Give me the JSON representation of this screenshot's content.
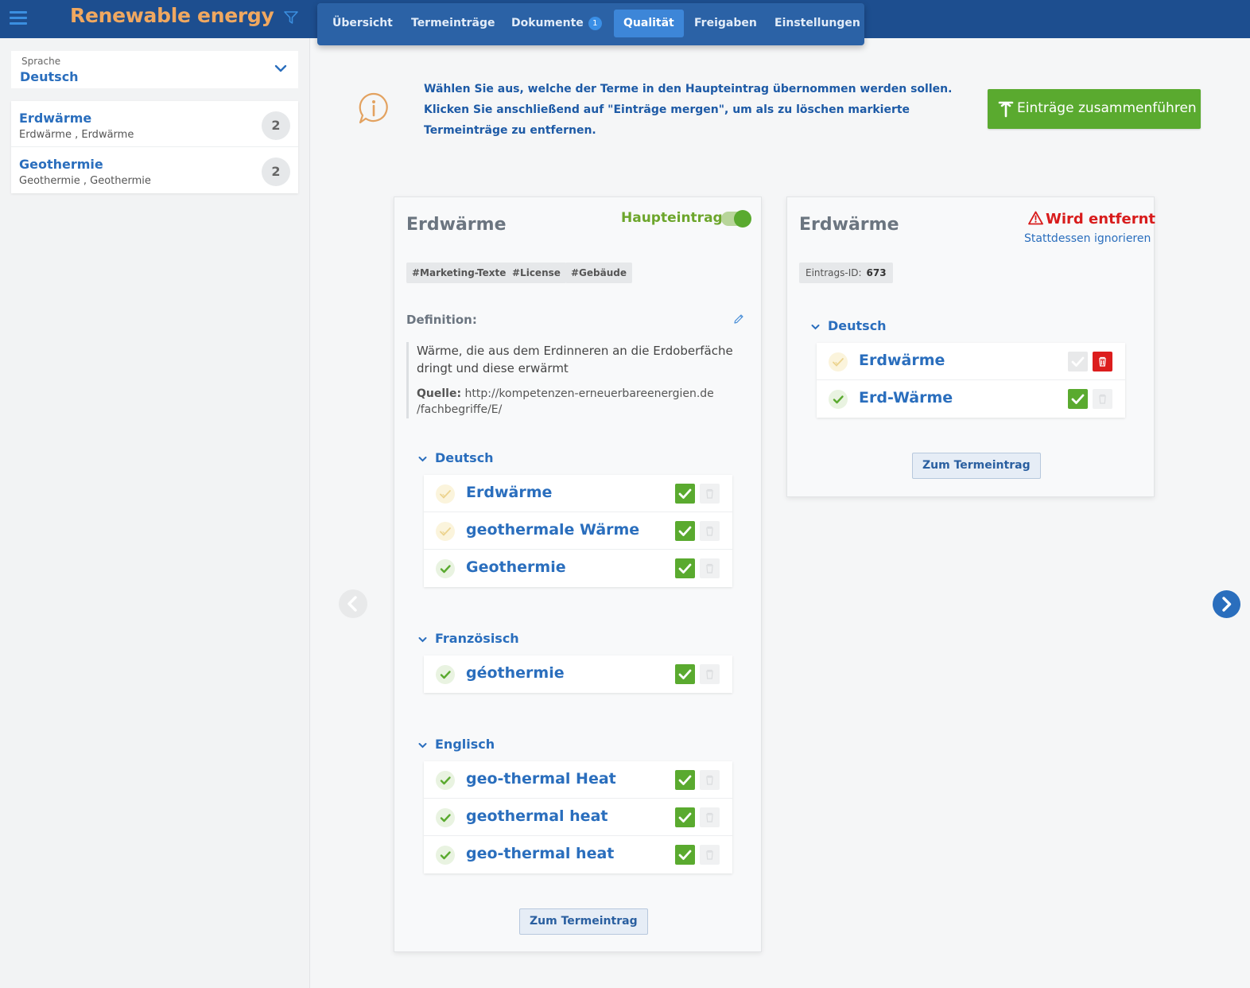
{
  "app": {
    "title": "Renewable energy"
  },
  "tabs": [
    {
      "label": "Übersicht"
    },
    {
      "label": "Termeinträge"
    },
    {
      "label": "Dokumente",
      "badge": "1"
    },
    {
      "label": "Qualität",
      "active": true
    },
    {
      "label": "Freigaben"
    },
    {
      "label": "Einstellungen"
    }
  ],
  "sidebar": {
    "language": {
      "label": "Sprache",
      "value": "Deutsch"
    },
    "entries": [
      {
        "title": "Erdwärme",
        "subtitle": "Erdwärme , Erdwärme",
        "count": "2"
      },
      {
        "title": "Geothermie",
        "subtitle": "Geothermie , Geothermie",
        "count": "2"
      }
    ]
  },
  "info": {
    "text": "Wählen Sie aus, welche der Terme in den Haupteintrag übernommen werden sollen. Klicken Sie anschließend auf \"Einträge mergen\", um als zu löschen markierte Termeinträge zu entfernen."
  },
  "merge_button": {
    "label": "Einträge zusammenführen"
  },
  "main_card": {
    "title": "Erdwärme",
    "main_entry_label": "Haupteintrag",
    "main_entry_on": true,
    "tags": [
      "#Marketing-Texte",
      "#License",
      "#Gebäude"
    ],
    "definition_label": "Definition:",
    "definition_text": "Wärme, die aus dem Erdinneren an die Erdoberfäche dringt und diese erwärmt",
    "source_label": "Quelle:",
    "source_value": "http://kompetenzen-erneuerbareenergien.de /fachbegriffe/E/",
    "languages": [
      {
        "name": "Deutsch",
        "terms": [
          {
            "text": "Erdwärme",
            "status": "pending",
            "checked": true
          },
          {
            "text": "geothermale Wärme",
            "status": "pending",
            "checked": true
          },
          {
            "text": "Geothermie",
            "status": "ok",
            "checked": true
          }
        ]
      },
      {
        "name": "Französisch",
        "terms": [
          {
            "text": "géothermie",
            "status": "ok",
            "checked": true
          }
        ]
      },
      {
        "name": "Englisch",
        "terms": [
          {
            "text": "geo-thermal Heat",
            "status": "ok",
            "checked": true
          },
          {
            "text": "geothermal heat",
            "status": "ok",
            "checked": true
          },
          {
            "text": "geo-thermal heat",
            "status": "ok",
            "checked": true
          }
        ]
      }
    ],
    "goto_label": "Zum Termeintrag"
  },
  "secondary_card": {
    "title": "Erdwärme",
    "warning": "Wird entfernt",
    "ignore_label": "Stattdessen ignorieren",
    "id_label": "Eintrags-ID:",
    "id_value": "673",
    "languages": [
      {
        "name": "Deutsch",
        "terms": [
          {
            "text": "Erdwärme",
            "status": "pending",
            "checked": false,
            "deleted": true
          },
          {
            "text": "Erd-Wärme",
            "status": "ok",
            "checked": true,
            "deleted": false
          }
        ]
      }
    ],
    "goto_label": "Zum Termeintrag"
  },
  "colors": {
    "accent": "#2a6ebd",
    "success": "#5aaa2f",
    "danger": "#d81c1c",
    "title": "#f0a860",
    "topbar": "#1d4e8f"
  },
  "icons": [
    "hamburger-icon",
    "filter-icon",
    "chevron-down-icon",
    "info-bubble-icon",
    "merge-icon",
    "pencil-icon",
    "warning-icon",
    "check-icon",
    "trash-icon",
    "chevron-left-icon",
    "chevron-right-icon"
  ]
}
